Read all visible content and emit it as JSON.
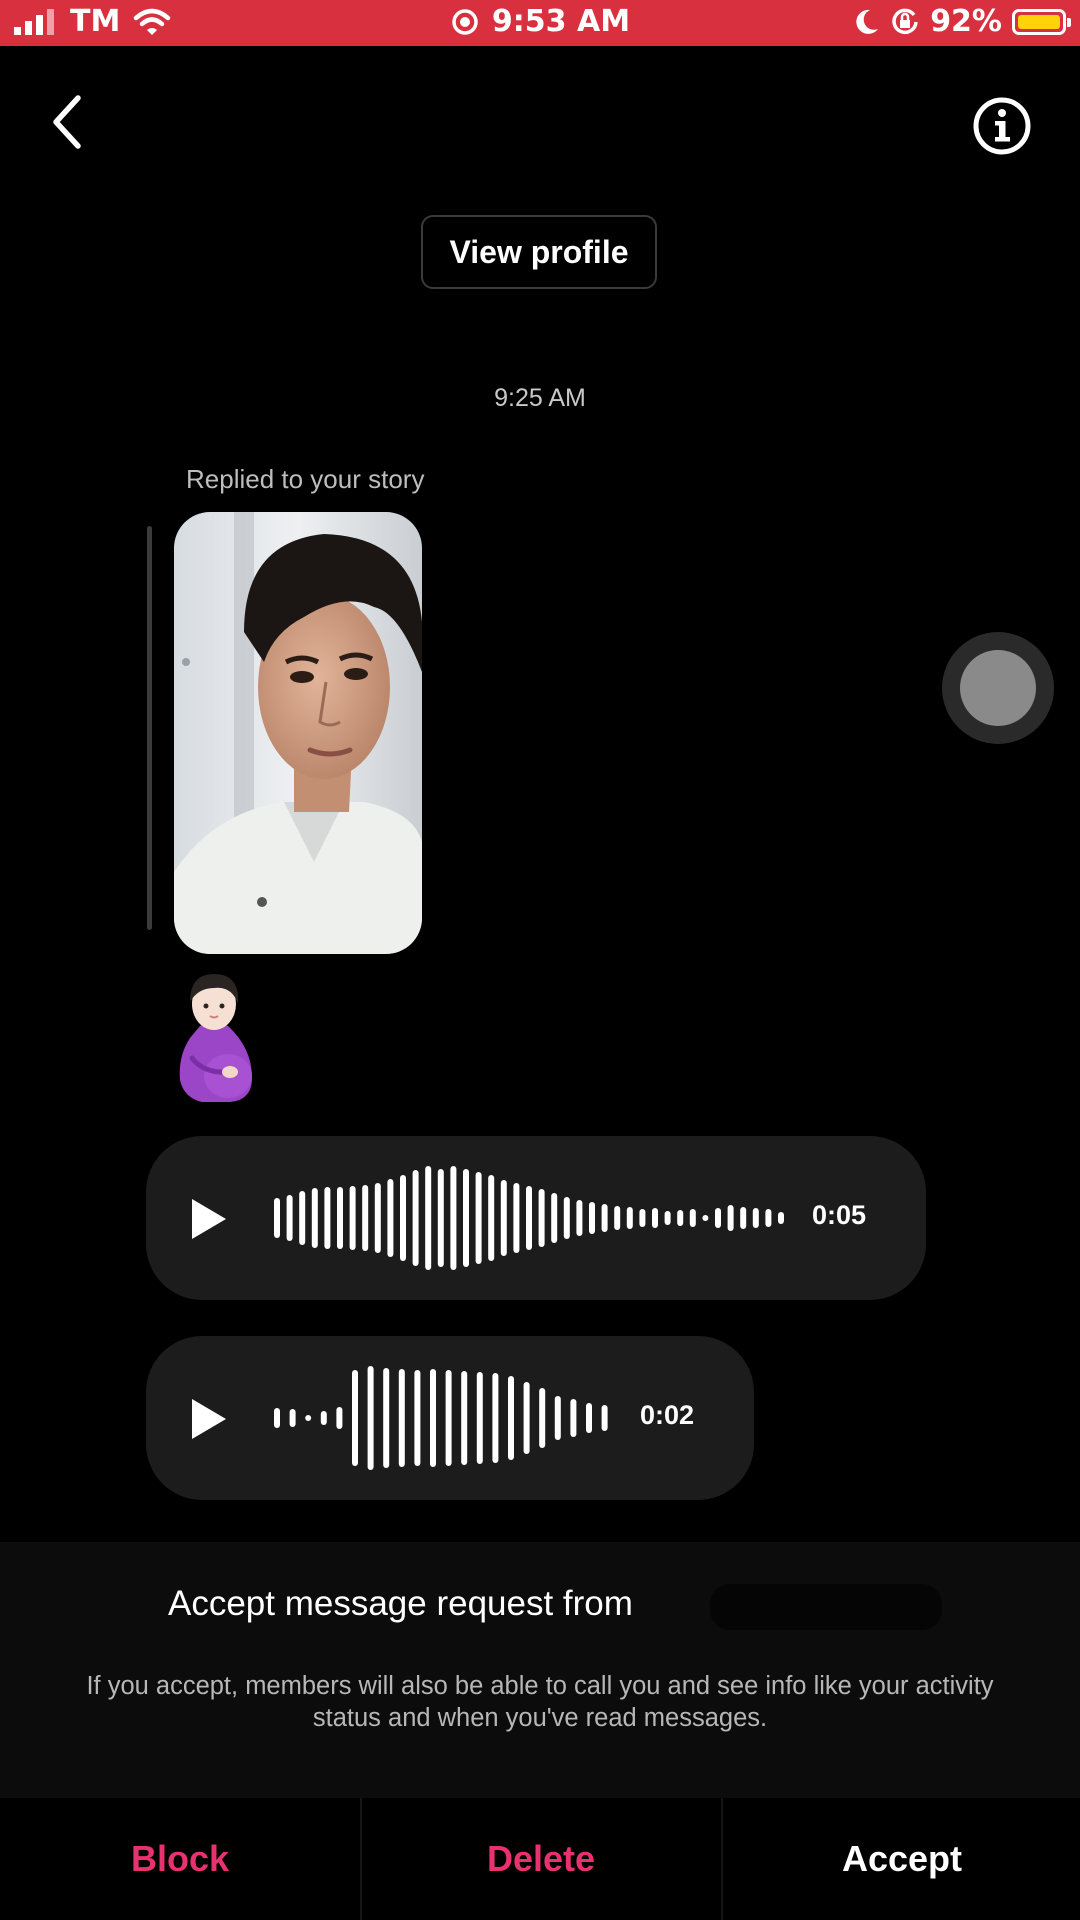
{
  "status_bar": {
    "carrier": "TM",
    "time": "9:53 AM",
    "battery_percent": "92%",
    "battery_level": 0.92,
    "bar_color": "#d8303f",
    "icons": [
      "signal-icon",
      "wifi-icon",
      "location-icon",
      "moon-icon",
      "orientation-lock-icon",
      "battery-icon"
    ]
  },
  "header": {
    "back_icon": "chevron-left-icon",
    "info_icon": "info-circle-icon"
  },
  "conversation": {
    "view_profile_label": "View profile",
    "timestamp": "9:25 AM",
    "story_reply": {
      "label": "Replied to your story",
      "emoji": "pregnant-woman-emoji"
    },
    "voice_messages": [
      {
        "duration": "0:05"
      },
      {
        "duration": "0:02"
      }
    ]
  },
  "request": {
    "title": "Accept message request from",
    "description": "If you accept, members will also be able to call you and see info like your activity status and when you've read messages."
  },
  "actions": {
    "block_label": "Block",
    "delete_label": "Delete",
    "accept_label": "Accept",
    "destructive_color": "#e8326f"
  }
}
